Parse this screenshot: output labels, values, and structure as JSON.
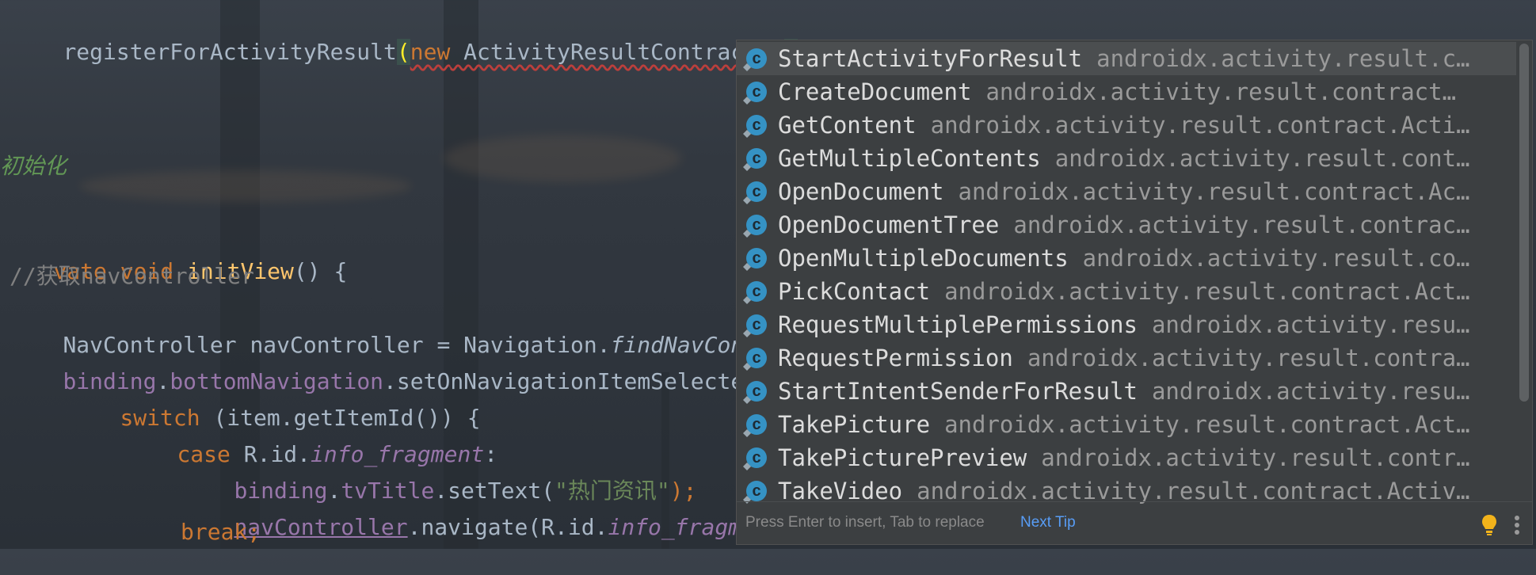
{
  "code": {
    "line1": {
      "method": "registerForActivityResult",
      "open_paren": "(",
      "kw_new": "new",
      "class_text": " ActivityResultContracts.",
      "close_paren": ")"
    },
    "comment_doc": "初始化",
    "line_method": {
      "modifier": "vate",
      "kw_void": "void",
      "name": "initView",
      "rest": "() {"
    },
    "comment_line": "//获取navController",
    "line_nav": {
      "type": "NavController navController = Navigation.",
      "call": "findNavCon"
    },
    "line_binding": {
      "obj": "binding",
      "dot": ".",
      "field": "bottomNavigation",
      "rest": ".setOnNavigationItemSelecte"
    },
    "line_switch": {
      "kw": "switch",
      "rest": " (item.getItemId()) {"
    },
    "line_case": {
      "kw": "case",
      "rest": " R.id.",
      "field": "info_fragment",
      "colon": ":"
    },
    "line_settext": {
      "obj": "binding",
      "dot": ".",
      "field": "tvTitle",
      "call": ".setText(",
      "str": "\"热门资讯\"",
      "end": ");"
    },
    "line_navigate": {
      "obj": "navController",
      "call": ".navigate(R.id.",
      "field": "info_fragme"
    },
    "line_break": "break;"
  },
  "completion": {
    "items": [
      {
        "name": "StartActivityForResult",
        "pkg": "androidx.activity.result.c…"
      },
      {
        "name": "CreateDocument",
        "pkg": "androidx.activity.result.contract…"
      },
      {
        "name": "GetContent",
        "pkg": "androidx.activity.result.contract.Acti…"
      },
      {
        "name": "GetMultipleContents",
        "pkg": "androidx.activity.result.cont…"
      },
      {
        "name": "OpenDocument",
        "pkg": "androidx.activity.result.contract.Ac…"
      },
      {
        "name": "OpenDocumentTree",
        "pkg": "androidx.activity.result.contrac…"
      },
      {
        "name": "OpenMultipleDocuments",
        "pkg": "androidx.activity.result.co…"
      },
      {
        "name": "PickContact",
        "pkg": "androidx.activity.result.contract.Act…"
      },
      {
        "name": "RequestMultiplePermissions",
        "pkg": "androidx.activity.resu…"
      },
      {
        "name": "RequestPermission",
        "pkg": "androidx.activity.result.contra…"
      },
      {
        "name": "StartIntentSenderForResult",
        "pkg": "androidx.activity.resu…"
      },
      {
        "name": "TakePicture",
        "pkg": "androidx.activity.result.contract.Act…"
      },
      {
        "name": "TakePicturePreview",
        "pkg": "androidx.activity.result.contr…"
      },
      {
        "name": "TakeVideo",
        "pkg": "androidx.activity.result.contract.Activ…"
      }
    ],
    "icon_letter": "c",
    "selected_index": 0,
    "footer_hint": "Press Enter to insert, Tab to replace",
    "footer_tip": "Next Tip",
    "icons": {
      "item": "class-icon",
      "bulb": "lightbulb-icon",
      "more": "more-vertical-icon"
    }
  },
  "colors": {
    "keyword": "#cc7832",
    "function": "#ffc66d",
    "field": "#9876aa",
    "string": "#6a8759",
    "popup_bg": "#3c3f41",
    "link": "#589df6"
  }
}
